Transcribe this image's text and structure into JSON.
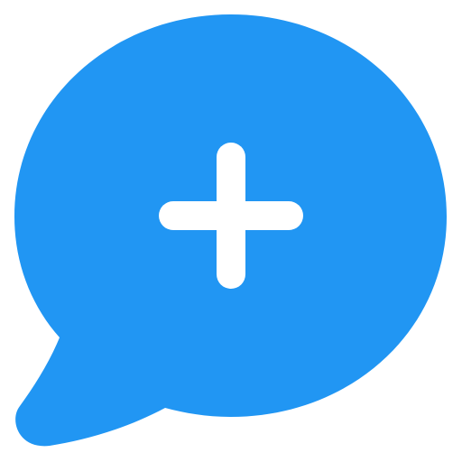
{
  "icon": {
    "name": "add-chat-icon",
    "bubble_color": "#2196F3",
    "plus_color": "#FFFFFF"
  }
}
